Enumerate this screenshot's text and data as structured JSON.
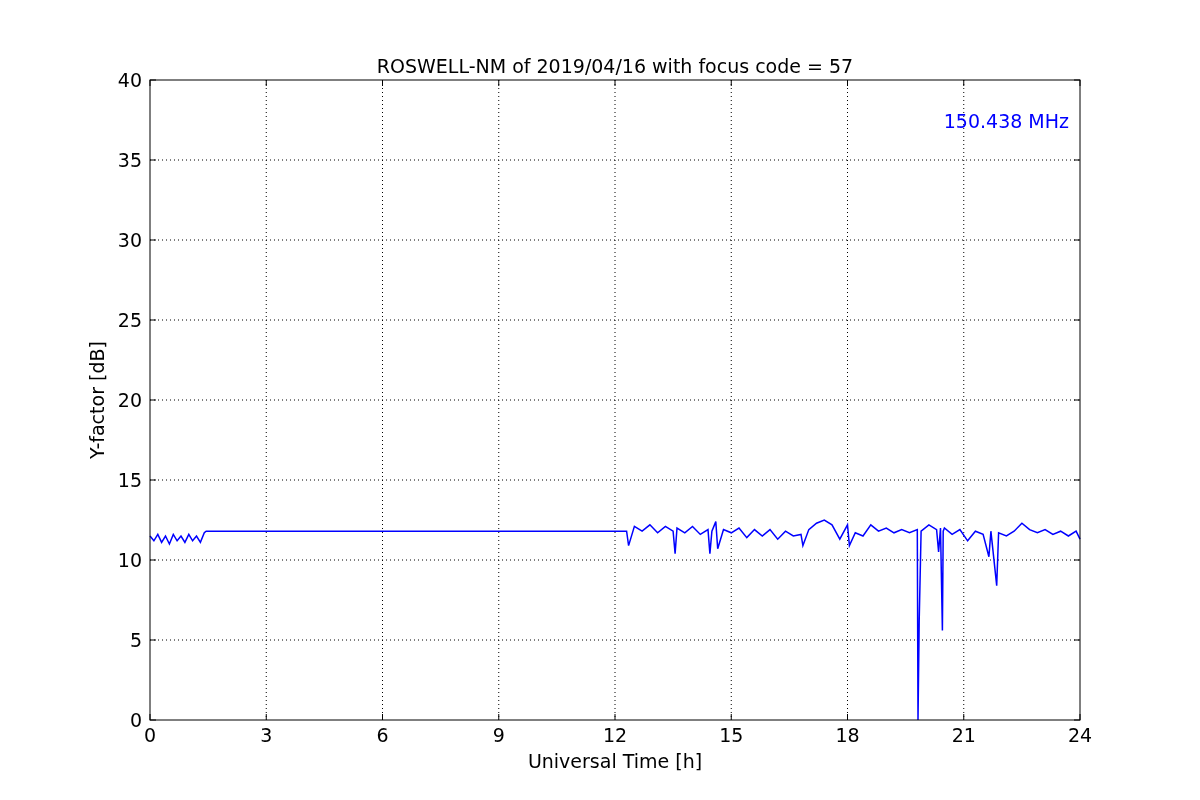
{
  "chart_data": {
    "type": "line",
    "title": "ROSWELL-NM of 2019/04/16 with focus code = 57",
    "xlabel": "Universal Time [h]",
    "ylabel": "Y-factor [dB]",
    "xlim": [
      0,
      24
    ],
    "ylim": [
      0,
      40
    ],
    "xticks": [
      0,
      3,
      6,
      9,
      12,
      15,
      18,
      21,
      24
    ],
    "yticks": [
      0,
      5,
      10,
      15,
      20,
      25,
      30,
      35,
      40
    ],
    "x": [
      0,
      0.1,
      0.2,
      0.3,
      0.4,
      0.5,
      0.6,
      0.7,
      0.8,
      0.9,
      1.0,
      1.1,
      1.2,
      1.3,
      1.4,
      1.45,
      12.3,
      12.35,
      12.5,
      12.7,
      12.9,
      13.1,
      13.3,
      13.5,
      13.55,
      13.6,
      13.8,
      14.0,
      14.2,
      14.4,
      14.45,
      14.5,
      14.6,
      14.65,
      14.8,
      15.0,
      15.2,
      15.4,
      15.6,
      15.8,
      16.0,
      16.2,
      16.4,
      16.6,
      16.8,
      16.85,
      17.0,
      17.2,
      17.4,
      17.6,
      17.8,
      18.0,
      18.05,
      18.2,
      18.4,
      18.6,
      18.8,
      19.0,
      19.2,
      19.4,
      19.6,
      19.8,
      19.82,
      19.85,
      19.9,
      20.1,
      20.3,
      20.35,
      20.4,
      20.45,
      20.47,
      20.5,
      20.7,
      20.9,
      21.1,
      21.3,
      21.5,
      21.65,
      21.7,
      21.85,
      21.9,
      22.1,
      22.3,
      22.5,
      22.7,
      22.9,
      23.1,
      23.3,
      23.5,
      23.7,
      23.9,
      24
    ],
    "series": [
      {
        "name": "150.438 MHz",
        "color": "#0000ff",
        "values": [
          11.5,
          11.2,
          11.6,
          11.1,
          11.5,
          11.0,
          11.6,
          11.2,
          11.5,
          11.1,
          11.6,
          11.2,
          11.5,
          11.1,
          11.7,
          11.8,
          11.8,
          10.9,
          12.1,
          11.8,
          12.2,
          11.7,
          12.1,
          11.8,
          10.4,
          12.0,
          11.7,
          12.1,
          11.6,
          11.9,
          10.4,
          11.8,
          12.4,
          10.7,
          11.9,
          11.7,
          12.0,
          11.4,
          11.9,
          11.5,
          11.9,
          11.3,
          11.8,
          11.5,
          11.6,
          10.9,
          11.9,
          12.3,
          12.5,
          12.2,
          11.3,
          12.2,
          10.9,
          11.7,
          11.5,
          12.2,
          11.8,
          12.0,
          11.7,
          11.9,
          11.7,
          11.9,
          0,
          6.2,
          11.8,
          12.2,
          11.9,
          10.5,
          12.0,
          5.6,
          11.8,
          12.0,
          11.6,
          11.9,
          11.2,
          11.8,
          11.6,
          10.2,
          11.8,
          8.4,
          11.7,
          11.5,
          11.8,
          12.3,
          11.9,
          11.7,
          11.9,
          11.6,
          11.8,
          11.5,
          11.8,
          11.3
        ]
      }
    ],
    "grid": true
  }
}
